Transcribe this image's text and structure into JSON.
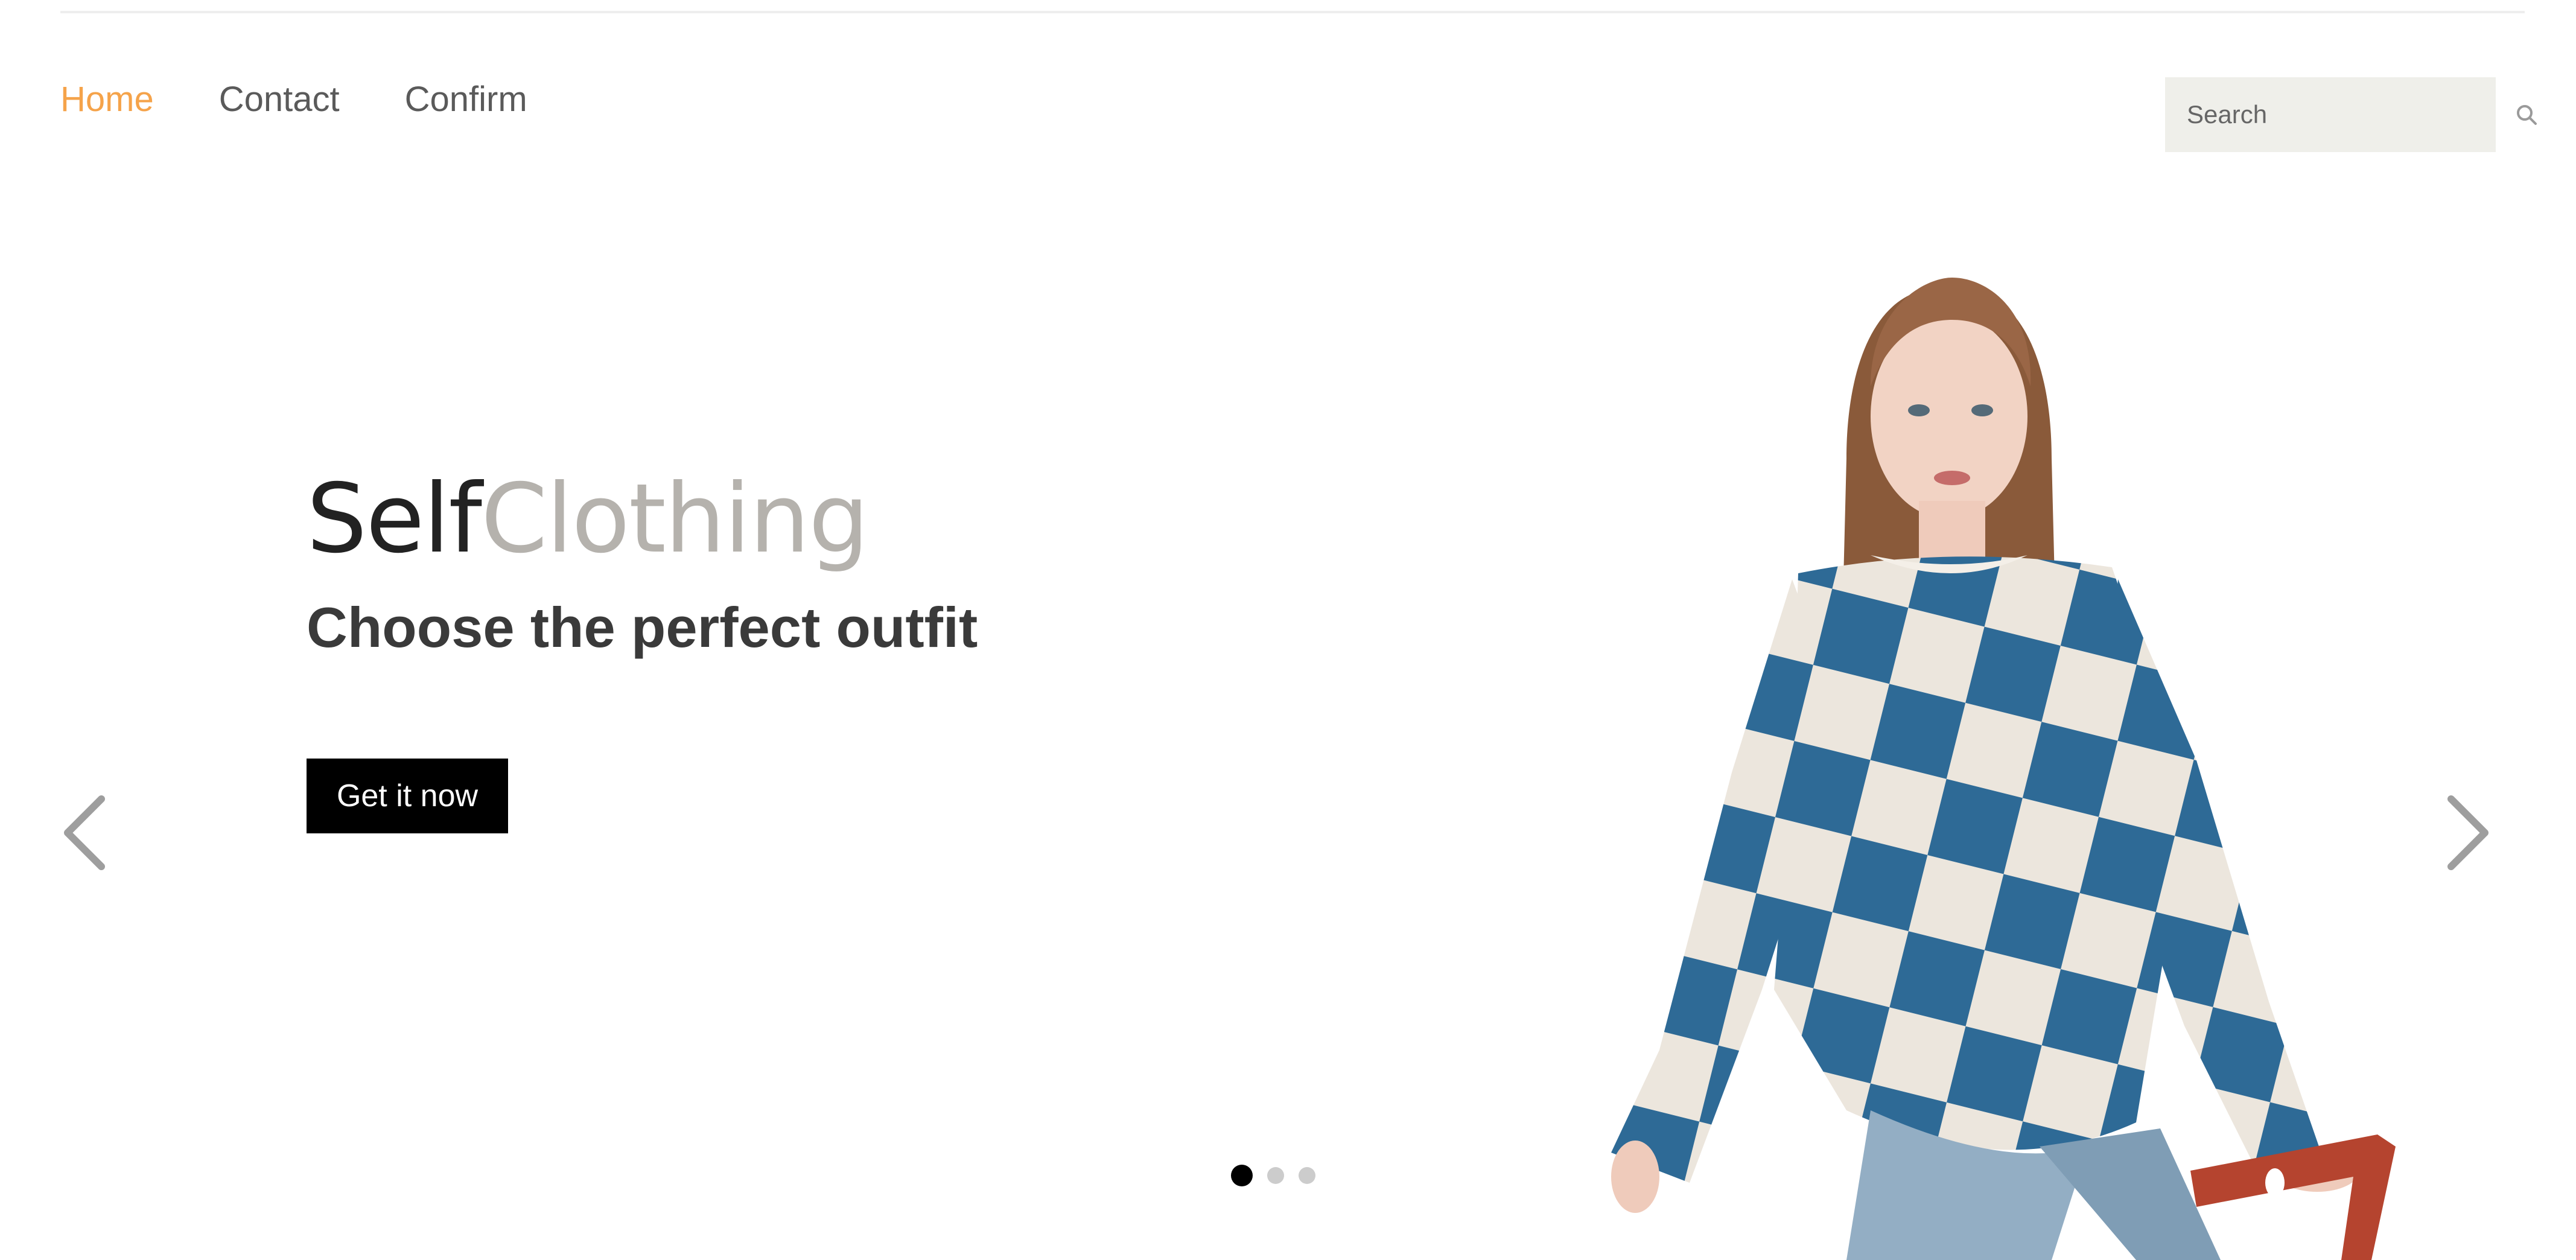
{
  "nav": {
    "items": [
      {
        "label": "Home",
        "active": true
      },
      {
        "label": "Contact",
        "active": false
      },
      {
        "label": "Confirm",
        "active": false
      }
    ]
  },
  "search": {
    "placeholder": "Search",
    "icon": "search-icon"
  },
  "hero": {
    "brand_part1": "Self",
    "brand_part2": "Clothing",
    "tagline": "Choose the perfect outfit",
    "cta_label": "Get it now",
    "image_subject": "model-in-checkered-sweater"
  },
  "carousel": {
    "prev_icon": "chevron-left-icon",
    "next_icon": "chevron-right-icon",
    "slides": 3,
    "active_slide": 1
  },
  "colors": {
    "accent": "#f5a34a",
    "text": "#5a5a5a",
    "brand_dark": "#222222",
    "brand_light": "#b5b2ad",
    "button_bg": "#000000",
    "search_bg": "#efefea",
    "sweater_blue": "#2e6a96",
    "sweater_cream": "#ece6dd"
  }
}
